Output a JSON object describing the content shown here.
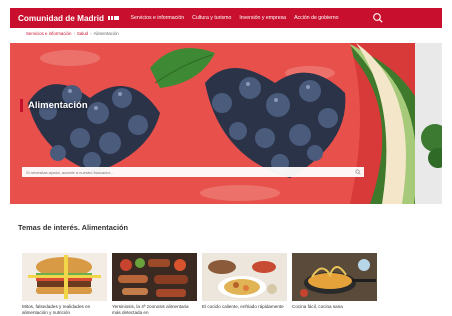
{
  "header": {
    "brand": "Comunidad de Madrid",
    "logo_icon": "madrid-flag-stars-icon",
    "nav": [
      "Servicios e información",
      "Cultura y turismo",
      "Inversión y empresa",
      "Acción de gobierno"
    ],
    "search_icon": "search-icon"
  },
  "breadcrumb": [
    "Servicios e información",
    "Salud",
    "Alimentación"
  ],
  "hero": {
    "title": "Alimentación",
    "search_placeholder": "Si necesitas ayuda, accede a nuestro buscador..."
  },
  "section_title": "Temas de interés. Alimentación",
  "cards": [
    {
      "label": "Mitos, falsedades y realidades en alimentación y nutrición"
    },
    {
      "label": "Yersiniosis, la 4ª zoonosis alimentaria más detectada en"
    },
    {
      "label": "El cocido caliente, enfriado rápidamente"
    },
    {
      "label": "Cocina fácil, cocina sana"
    }
  ],
  "colors": {
    "brand_red": "#c8102e",
    "watermelon": "#e8504c",
    "blueberry": "#2a3348"
  }
}
